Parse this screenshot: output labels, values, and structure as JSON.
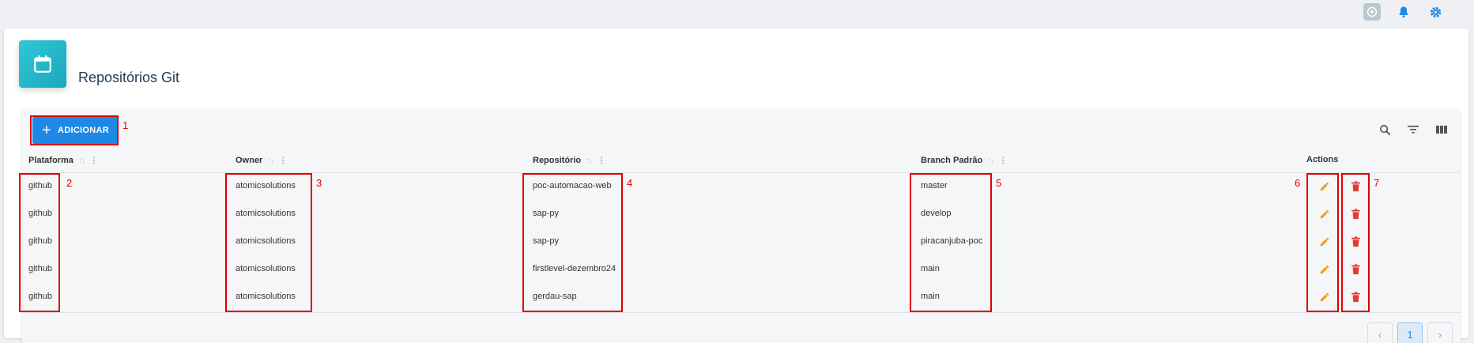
{
  "topbar": {
    "icons": [
      "ai-assistant-icon",
      "bell-icon",
      "gear-icon"
    ]
  },
  "header": {
    "icon": "calendar-icon",
    "title": "Repositórios Git"
  },
  "toolbar": {
    "add_label": "ADICIONAR",
    "right_icons": [
      "search-icon",
      "filter-icon",
      "columns-icon"
    ]
  },
  "table": {
    "columns": [
      "Plataforma",
      "Owner",
      "Repositório",
      "Branch Padrão",
      "Actions"
    ],
    "rows": [
      {
        "platform": "github",
        "owner": "atomicsolutions",
        "repo": "poc-automacao-web",
        "branch": "master"
      },
      {
        "platform": "github",
        "owner": "atomicsolutions",
        "repo": "sap-py",
        "branch": "develop"
      },
      {
        "platform": "github",
        "owner": "atomicsolutions",
        "repo": "sap-py",
        "branch": "piracanjuba-poc"
      },
      {
        "platform": "github",
        "owner": "atomicsolutions",
        "repo": "firstlevel-dezembro24",
        "branch": "main"
      },
      {
        "platform": "github",
        "owner": "atomicsolutions",
        "repo": "gerdau-sap",
        "branch": "main"
      }
    ]
  },
  "pagination": {
    "prev": "‹",
    "current": "1",
    "next": "›"
  },
  "annotations": [
    "1",
    "2",
    "3",
    "4",
    "5",
    "6",
    "7"
  ],
  "colors": {
    "primary": "#1e88e5",
    "edit": "#f39c12",
    "delete": "#e53935",
    "annotation": "#e00000"
  }
}
